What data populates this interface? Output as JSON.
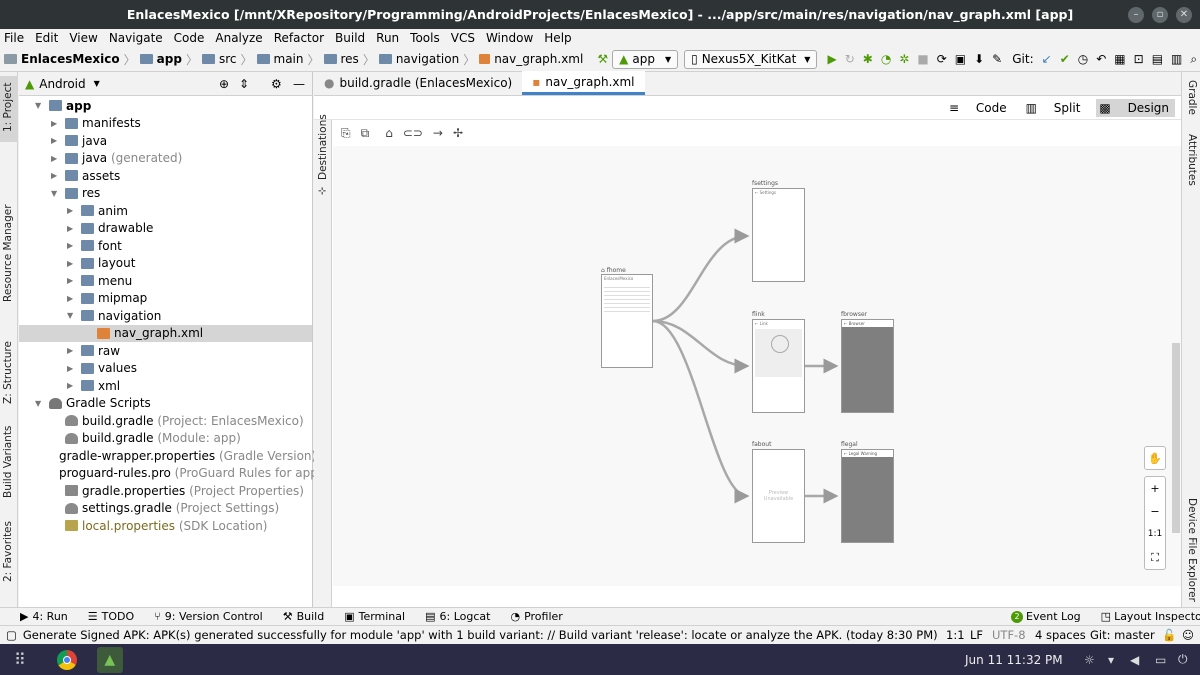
{
  "window": {
    "title": "EnlacesMexico [/mnt/XRepository/Programming/AndroidProjects/EnlacesMexico] - .../app/src/main/res/navigation/nav_graph.xml [app]"
  },
  "menu": [
    "File",
    "Edit",
    "View",
    "Navigate",
    "Code",
    "Analyze",
    "Refactor",
    "Build",
    "Run",
    "Tools",
    "VCS",
    "Window",
    "Help"
  ],
  "breadcrumb": [
    "EnlacesMexico",
    "app",
    "src",
    "main",
    "res",
    "navigation",
    "nav_graph.xml"
  ],
  "toolbar": {
    "run_config": "app",
    "device": "Nexus5X_KitKat",
    "git_label": "Git:"
  },
  "left_tools": [
    "1: Project",
    "Resource Manager",
    "Z: Structure",
    "Build Variants",
    "2: Favorites"
  ],
  "right_tools": [
    "Gradle",
    "Attributes",
    "Device File Explorer"
  ],
  "project": {
    "view": "Android",
    "tree": [
      {
        "label": "app",
        "suffix": "",
        "indent": 0,
        "kind": "module",
        "expanded": true
      },
      {
        "label": "manifests",
        "suffix": "",
        "indent": 1,
        "kind": "folder",
        "expanded": false
      },
      {
        "label": "java",
        "suffix": "",
        "indent": 1,
        "kind": "folder",
        "expanded": false
      },
      {
        "label": "java",
        "suffix": " (generated)",
        "indent": 1,
        "kind": "folder",
        "expanded": false
      },
      {
        "label": "assets",
        "suffix": "",
        "indent": 1,
        "kind": "folder",
        "expanded": false
      },
      {
        "label": "res",
        "suffix": "",
        "indent": 1,
        "kind": "folder",
        "expanded": true
      },
      {
        "label": "anim",
        "suffix": "",
        "indent": 2,
        "kind": "folder",
        "expanded": false
      },
      {
        "label": "drawable",
        "suffix": "",
        "indent": 2,
        "kind": "folder",
        "expanded": false
      },
      {
        "label": "font",
        "suffix": "",
        "indent": 2,
        "kind": "folder",
        "expanded": false
      },
      {
        "label": "layout",
        "suffix": "",
        "indent": 2,
        "kind": "folder",
        "expanded": false
      },
      {
        "label": "menu",
        "suffix": "",
        "indent": 2,
        "kind": "folder",
        "expanded": false
      },
      {
        "label": "mipmap",
        "suffix": "",
        "indent": 2,
        "kind": "folder",
        "expanded": false
      },
      {
        "label": "navigation",
        "suffix": "",
        "indent": 2,
        "kind": "folder",
        "expanded": true
      },
      {
        "label": "nav_graph.xml",
        "suffix": "",
        "indent": 3,
        "kind": "xml",
        "expanded": null,
        "selected": true
      },
      {
        "label": "raw",
        "suffix": "",
        "indent": 2,
        "kind": "folder",
        "expanded": false
      },
      {
        "label": "values",
        "suffix": "",
        "indent": 2,
        "kind": "folder",
        "expanded": false
      },
      {
        "label": "xml",
        "suffix": "",
        "indent": 2,
        "kind": "folder",
        "expanded": false
      },
      {
        "label": "Gradle Scripts",
        "suffix": "",
        "indent": 0,
        "kind": "gradle",
        "expanded": true
      },
      {
        "label": "build.gradle",
        "suffix": " (Project: EnlacesMexico)",
        "indent": 1,
        "kind": "gradlefile",
        "expanded": null
      },
      {
        "label": "build.gradle",
        "suffix": " (Module: app)",
        "indent": 1,
        "kind": "gradlefile",
        "expanded": null
      },
      {
        "label": "gradle-wrapper.properties",
        "suffix": " (Gradle Version)",
        "indent": 1,
        "kind": "props",
        "expanded": null
      },
      {
        "label": "proguard-rules.pro",
        "suffix": " (ProGuard Rules for app)",
        "indent": 1,
        "kind": "pro",
        "expanded": null
      },
      {
        "label": "gradle.properties",
        "suffix": " (Project Properties)",
        "indent": 1,
        "kind": "props",
        "expanded": null
      },
      {
        "label": "settings.gradle",
        "suffix": " (Project Settings)",
        "indent": 1,
        "kind": "gradlefile",
        "expanded": null
      },
      {
        "label": "local.properties",
        "suffix": " (SDK Location)",
        "indent": 1,
        "kind": "local",
        "expanded": null
      }
    ]
  },
  "editor": {
    "tabs": [
      {
        "label": "build.gradle (EnlacesMexico)",
        "active": false
      },
      {
        "label": "nav_graph.xml",
        "active": true
      }
    ],
    "modes": [
      "Code",
      "Split",
      "Design"
    ],
    "active_mode": "Design",
    "destinations_label": "Destinations"
  },
  "nav_graph": {
    "destinations": {
      "home": {
        "label": "fhome",
        "start": true,
        "title": "EnlacesMexico"
      },
      "settings": {
        "label": "fsettings",
        "title": "Settings"
      },
      "link": {
        "label": "flink",
        "title": "Link"
      },
      "browser": {
        "label": "fbrowser",
        "title": "Browser"
      },
      "about": {
        "label": "fabout",
        "preview_text": "Preview Unavailable"
      },
      "legal": {
        "label": "flegal",
        "title": "Legal Warning"
      }
    }
  },
  "zoom": {
    "fit": "1:1"
  },
  "bottom_tools": [
    "4: Run",
    "TODO",
    "9: Version Control",
    "Build",
    "Terminal",
    "6: Logcat",
    "Profiler"
  ],
  "bottom_right": {
    "event_log": "Event Log",
    "event_count": "2",
    "layout_inspector": "Layout Inspector"
  },
  "status": {
    "message": "Generate Signed APK: APK(s) generated successfully for module 'app' with 1 build variant: // Build variant 'release': locate or analyze the APK. (today 8:30 PM)",
    "position": "1:1",
    "line_sep": "LF",
    "encoding": "UTF-8",
    "indent": "4 spaces",
    "git": "Git: master"
  },
  "taskbar": {
    "clock": "Jun 11  11:32 PM"
  },
  "colors": {
    "accent": "#4083c9",
    "titlebar": "#2e3436",
    "taskbar": "#2b2b45"
  }
}
